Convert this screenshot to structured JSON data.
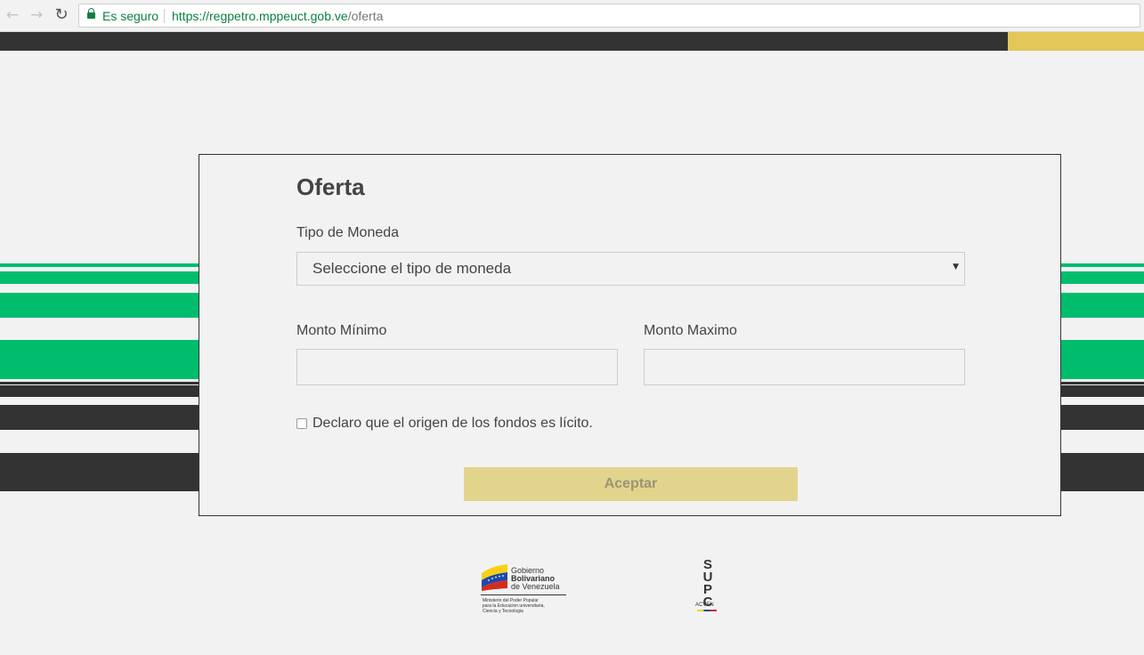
{
  "browser": {
    "secure_label": "Es seguro",
    "url_host": "https://regpetro.mppeuct.gob.ve",
    "url_path": "/oferta"
  },
  "form": {
    "title": "Oferta",
    "currency_label": "Tipo de Moneda",
    "currency_placeholder": "Seleccione el tipo de moneda",
    "min_label": "Monto Mínimo",
    "min_value": "",
    "max_label": "Monto Maximo",
    "max_value": "",
    "checkbox_label": "Declaro que el origen de los fondos es lícito.",
    "checkbox_checked": false,
    "submit_label": "Aceptar"
  },
  "footer": {
    "gob_line1": "Gobierno",
    "gob_line2": "Bolivariano",
    "gob_line3": "de Venezuela",
    "gob_sub1": "Ministerio del Poder Popular",
    "gob_sub2": "para la Educacion universitaria,",
    "gob_sub3": "Ciencia y Tecnologia",
    "supc_s": "S",
    "supc_u": "U",
    "supc_p": "P",
    "supc_c": "C",
    "supc_sub": "ACVEN"
  },
  "colors": {
    "green": "#00bd6e",
    "dark": "#333333",
    "gold": "#e1c858",
    "button": "#e2d48c"
  }
}
